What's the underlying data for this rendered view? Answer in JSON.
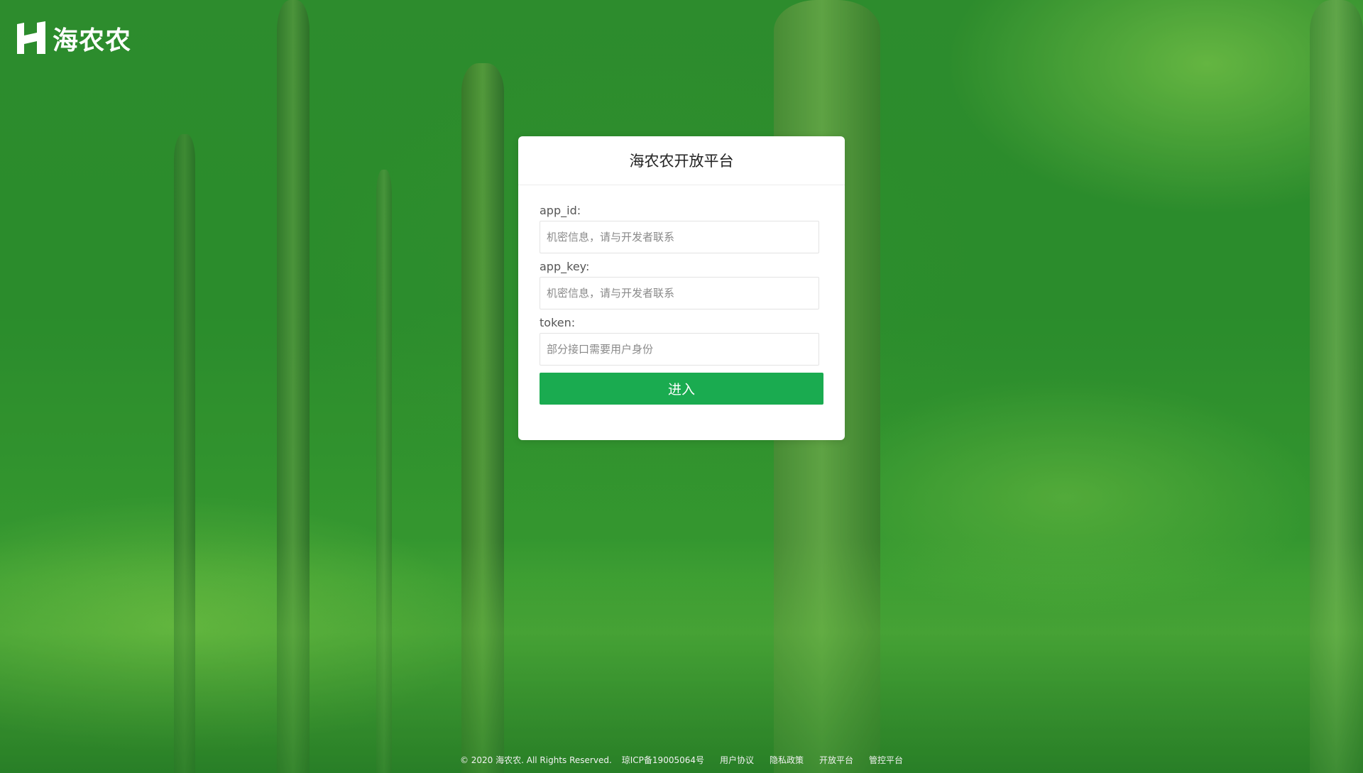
{
  "brand": {
    "logo_text": "海农农"
  },
  "login": {
    "title": "海农农开放平台",
    "fields": [
      {
        "label": "app_id:",
        "placeholder": "机密信息，请与开发者联系",
        "value": ""
      },
      {
        "label": "app_key:",
        "placeholder": "机密信息，请与开发者联系",
        "value": ""
      },
      {
        "label": "token:",
        "placeholder": "部分接口需要用户身份",
        "value": ""
      }
    ],
    "submit_label": "进入"
  },
  "footer": {
    "copyright": "© 2020 海农农. All Rights Reserved.",
    "icp": "琼ICP备19005064号",
    "links": [
      "用户协议",
      "隐私政策",
      "开放平台",
      "管控平台"
    ]
  },
  "colors": {
    "accent": "#1aab50",
    "card_background": "#ffffff",
    "page_tint": "#2c8a2b"
  },
  "icons": {
    "logo": "h-logo-icon"
  }
}
